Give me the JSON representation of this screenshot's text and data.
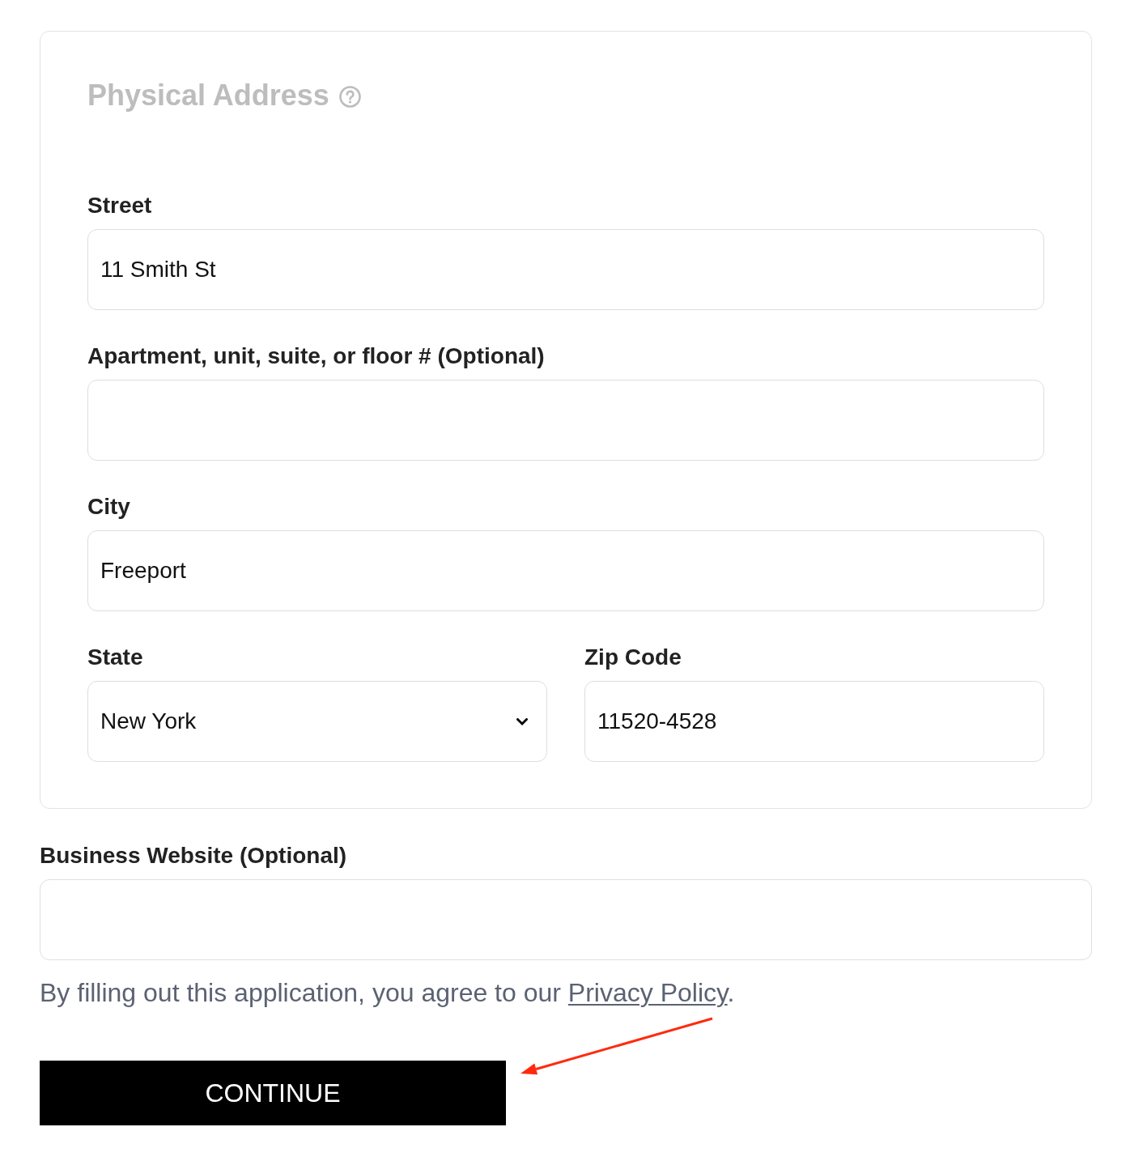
{
  "address_section": {
    "title": "Physical Address",
    "rows": [
      {
        "fields": [
          {
            "kind": "text",
            "label": "Street",
            "value": "11 Smith St"
          }
        ]
      },
      {
        "fields": [
          {
            "kind": "text",
            "label": "Apartment, unit, suite, or floor # (Optional)"
          }
        ]
      },
      {
        "fields": [
          {
            "kind": "text",
            "label": "City",
            "value": "Freeport"
          }
        ]
      },
      {
        "fields": [
          {
            "kind": "select",
            "label": "State",
            "value": "New York"
          },
          {
            "kind": "text",
            "label": "Zip Code",
            "value": "11520-4528"
          }
        ]
      }
    ]
  },
  "website_field": {
    "kind": "text",
    "label": "Business Website (Optional)"
  },
  "consent": {
    "text": "By filling out this application, you agree to our",
    "link": "Privacy Policy",
    "end": "."
  },
  "continue_button": {
    "label": "CONTINUE"
  },
  "annotations": [
    {
      "kind": "arrow"
    }
  ]
}
